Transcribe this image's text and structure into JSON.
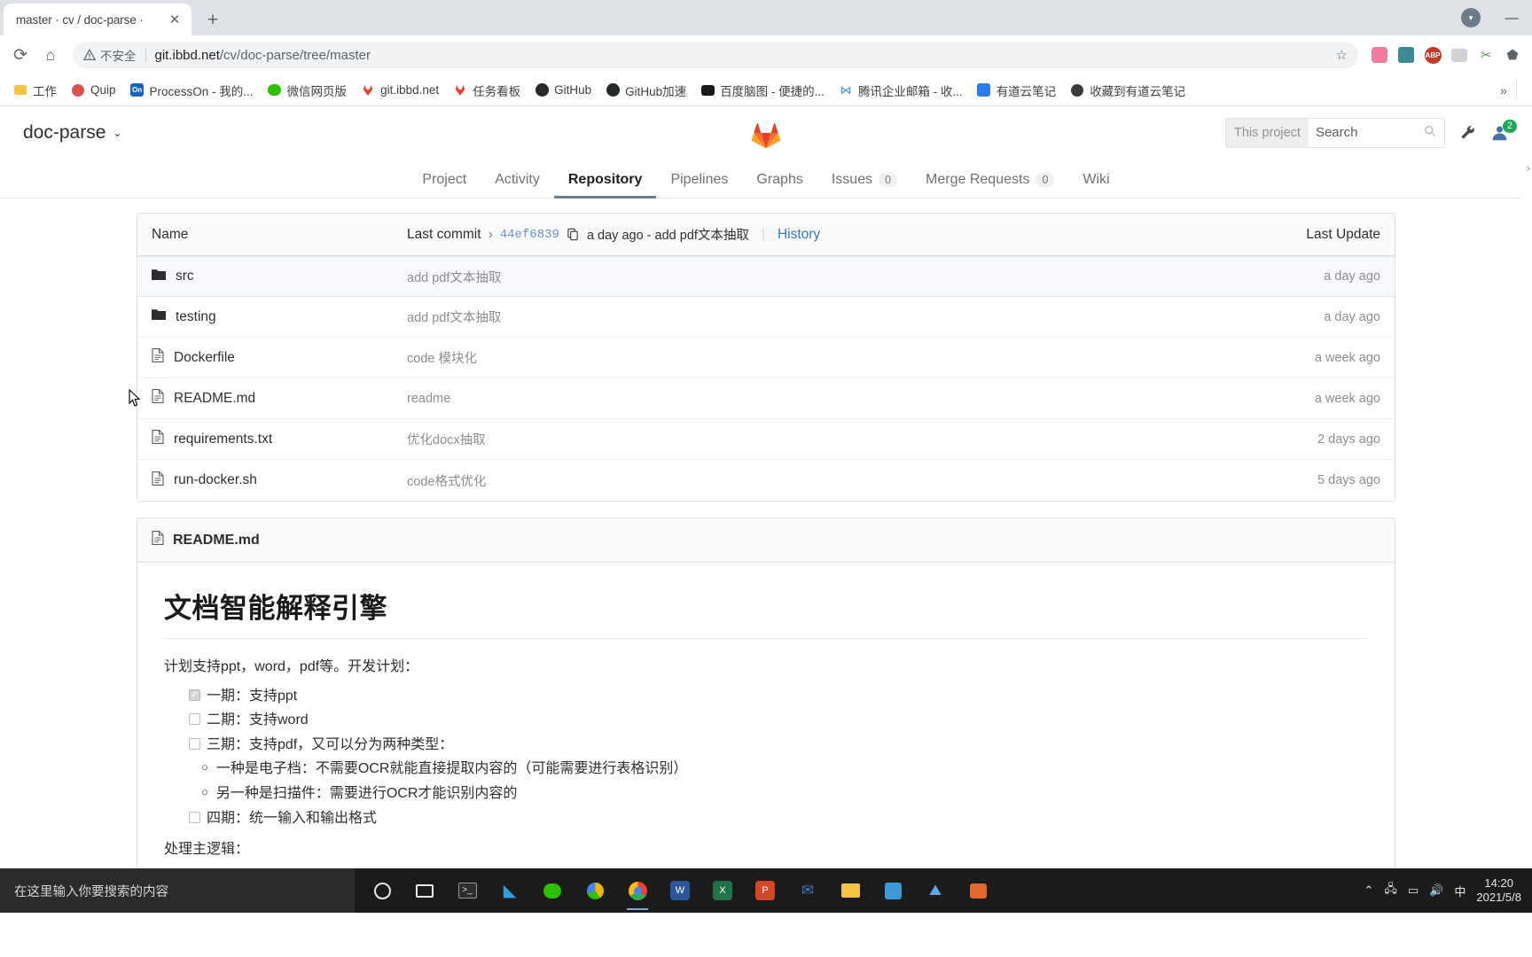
{
  "browser": {
    "tab": {
      "title": "master · cv / doc-parse ·",
      "close_label": "✕"
    },
    "newtab_label": "+",
    "window_controls": {
      "minimize": "—",
      "profile": "▾"
    },
    "toolbar": {
      "reload_label": "⟳",
      "home_label": "⌂",
      "security_label": "不安全",
      "url_host": "git.ibbd.net",
      "url_path": "/cv/doc-parse/tree/master",
      "star_label": "☆"
    },
    "extensions": [
      {
        "name": "extension-pink",
        "glyph": "◈",
        "color": "#f27ba0"
      },
      {
        "name": "extension-teal",
        "glyph": "▤",
        "color": "#3b8a94"
      },
      {
        "name": "adblock",
        "glyph": "ABP",
        "color": "#c0392b"
      },
      {
        "name": "extension-gray",
        "glyph": "▭",
        "color": "#9aa0a6"
      },
      {
        "name": "extension-green",
        "glyph": "✂",
        "color": "#4e9a4e"
      },
      {
        "name": "extension-puzzle",
        "glyph": "🧩",
        "color": "#5f6368"
      }
    ],
    "bookmarks": [
      {
        "label": "工作",
        "icon": "folder-icon",
        "color": "#f5c242"
      },
      {
        "label": "Quip",
        "icon": "quip-icon",
        "color": "#d9534f"
      },
      {
        "label": "ProcessOn - 我的...",
        "icon": "processon-icon",
        "color": "#1565c0"
      },
      {
        "label": "微信网页版",
        "icon": "wechat-icon",
        "color": "#2dc100"
      },
      {
        "label": "git.ibbd.net",
        "icon": "gitlab-icon",
        "color": "#e24329"
      },
      {
        "label": "任务看板",
        "icon": "gitlab-icon",
        "color": "#e24329"
      },
      {
        "label": "GitHub",
        "icon": "github-icon",
        "color": "#24292e"
      },
      {
        "label": "GitHub加速",
        "icon": "github-icon",
        "color": "#24292e"
      },
      {
        "label": "百度脑图 - 便捷的...",
        "icon": "baidu-naotu-icon",
        "color": "#1a1a1a"
      },
      {
        "label": "腾讯企业邮箱 - 收...",
        "icon": "tencent-mail-icon",
        "color": "#3a8fd9"
      },
      {
        "label": "有道云笔记",
        "icon": "youdao-icon",
        "color": "#2a7ded"
      },
      {
        "label": "收藏到有道云笔记",
        "icon": "youdao-clip-icon",
        "color": "#3a3a3a"
      }
    ],
    "bookmarks_overflow": "»"
  },
  "gitlab": {
    "project_name": "doc-parse",
    "caret": "⌄",
    "search": {
      "scope": "This project",
      "placeholder": "Search",
      "icon": "search-icon"
    },
    "header_icons": {
      "wrench": "wrench-icon",
      "user": "user-icon",
      "badge_count": "2"
    },
    "nav": [
      {
        "label": "Project",
        "active": false,
        "badge": null
      },
      {
        "label": "Activity",
        "active": false,
        "badge": null
      },
      {
        "label": "Repository",
        "active": true,
        "badge": null
      },
      {
        "label": "Pipelines",
        "active": false,
        "badge": null
      },
      {
        "label": "Graphs",
        "active": false,
        "badge": null
      },
      {
        "label": "Issues",
        "active": false,
        "badge": "0"
      },
      {
        "label": "Merge Requests",
        "active": false,
        "badge": "0"
      },
      {
        "label": "Wiki",
        "active": false,
        "badge": null
      }
    ],
    "file_table": {
      "headers": {
        "name": "Name",
        "last_commit": "Last commit",
        "last_update": "Last Update"
      },
      "head_commit": {
        "chevron": "›",
        "sha": "44ef6839",
        "copy_icon": "copy-icon",
        "meta": "a day ago - add pdf文本抽取",
        "history_link": "History"
      },
      "rows": [
        {
          "name": "src",
          "type": "folder",
          "commit": "add pdf文本抽取",
          "date": "a day ago",
          "hover": true
        },
        {
          "name": "testing",
          "type": "folder",
          "commit": "add pdf文本抽取",
          "date": "a day ago",
          "hover": false
        },
        {
          "name": "Dockerfile",
          "type": "file",
          "commit": "code 模块化",
          "date": "a week ago",
          "hover": false
        },
        {
          "name": "README.md",
          "type": "file",
          "commit": "readme",
          "date": "a week ago",
          "hover": false
        },
        {
          "name": "requirements.txt",
          "type": "file",
          "commit": "优化docx抽取",
          "date": "2 days ago",
          "hover": false
        },
        {
          "name": "run-docker.sh",
          "type": "file",
          "commit": "code格式优化",
          "date": "5 days ago",
          "hover": false
        }
      ]
    },
    "readme": {
      "header_title": "README.md",
      "header_icon": "file-icon",
      "h1": "文档智能解释引擎",
      "intro": "计划支持ppt，word，pdf等。开发计划：",
      "tasks": [
        {
          "checked": true,
          "label": "一期：支持ppt",
          "children": []
        },
        {
          "checked": false,
          "label": "二期：支持word",
          "children": []
        },
        {
          "checked": false,
          "label": "三期：支持pdf，又可以分为两种类型：",
          "children": [
            "一种是电子档：不需要OCR就能直接提取内容的（可能需要进行表格识别）",
            "另一种是扫描件：需要进行OCR才能识别内容的"
          ]
        },
        {
          "checked": false,
          "label": "四期：统一输入和输出格式",
          "children": []
        }
      ],
      "footer_line": "处理主逻辑："
    }
  },
  "taskbar": {
    "search_placeholder": "在这里输入你要搜索的内容",
    "items": [
      {
        "name": "cortana-icon",
        "glyph": "◯",
        "color": "#ffffff",
        "active": false
      },
      {
        "name": "task-view-icon",
        "glyph": "❏",
        "color": "#ffffff",
        "active": false
      },
      {
        "name": "terminal-icon",
        "glyph": "▣",
        "color": "#d8d8d8",
        "active": false
      },
      {
        "name": "vscode-icon",
        "glyph": "‹›",
        "color": "#2f9fe0",
        "active": false
      },
      {
        "name": "wechat-icon",
        "glyph": "✆",
        "color": "#2dc100",
        "active": false
      },
      {
        "name": "chrome-canary-icon",
        "glyph": "◉",
        "color": "#f2b705",
        "active": false
      },
      {
        "name": "chrome-icon",
        "glyph": "◉",
        "color": "#4285f4",
        "active": true
      },
      {
        "name": "word-icon",
        "glyph": "W",
        "color": "#2b579a",
        "active": false
      },
      {
        "name": "excel-icon",
        "glyph": "X",
        "color": "#217346",
        "active": false
      },
      {
        "name": "powerpoint-icon",
        "glyph": "P",
        "color": "#d24726",
        "active": false
      },
      {
        "name": "foxmail-icon",
        "glyph": "✉",
        "color": "#3d7ebf",
        "active": false
      },
      {
        "name": "explorer-icon",
        "glyph": "🗀",
        "color": "#f5c242",
        "active": false
      },
      {
        "name": "app-blue-icon",
        "glyph": "▦",
        "color": "#3e9ad6",
        "active": false
      },
      {
        "name": "app-chart-icon",
        "glyph": "📈",
        "color": "#5aa9e6",
        "active": false
      },
      {
        "name": "camera-icon",
        "glyph": "▩",
        "color": "#e06a2b",
        "active": false
      }
    ],
    "tray": {
      "chevron": "⌃",
      "network": "network-icon",
      "battery": "battery-icon",
      "volume": "volume-icon",
      "ime": "中",
      "time": "14:20",
      "date": "2021/5/8"
    }
  }
}
